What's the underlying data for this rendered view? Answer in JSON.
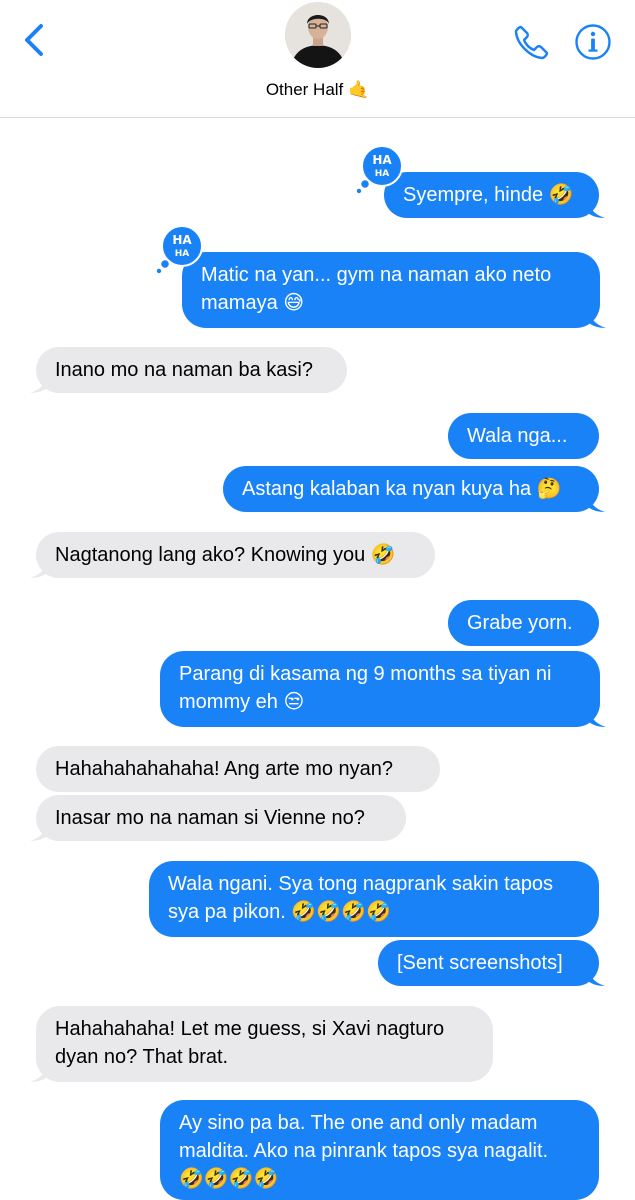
{
  "contact": {
    "name": "Other Half 🤙"
  },
  "tapback": {
    "line1": "HA",
    "line2": "HA"
  },
  "messages": [
    {
      "dir": "sent",
      "lines": [
        "Syempre, hinde 🤣"
      ]
    },
    {
      "dir": "sent",
      "lines": [
        "Matic na yan... gym na naman ako neto",
        "mamaya 😅"
      ]
    },
    {
      "dir": "recv",
      "lines": [
        "Inano mo na naman ba kasi?"
      ]
    },
    {
      "dir": "sent",
      "lines": [
        "Wala nga..."
      ]
    },
    {
      "dir": "sent",
      "lines": [
        "Astang kalaban ka nyan kuya ha 🤔"
      ]
    },
    {
      "dir": "recv",
      "lines": [
        "Nagtanong lang ako? Knowing you 🤣"
      ]
    },
    {
      "dir": "sent",
      "lines": [
        "Grabe yorn."
      ]
    },
    {
      "dir": "sent",
      "lines": [
        "Parang di kasama ng 9 months sa tiyan ni",
        "mommy eh 😒"
      ]
    },
    {
      "dir": "recv",
      "lines": [
        "Hahahahahahaha! Ang arte mo nyan?"
      ]
    },
    {
      "dir": "recv",
      "lines": [
        "Inasar mo na naman si Vienne no?"
      ]
    },
    {
      "dir": "sent",
      "lines": [
        "Wala ngani. Sya tong nagprank sakin tapos",
        "sya pa pikon. 🤣🤣🤣🤣"
      ]
    },
    {
      "dir": "sent",
      "lines": [
        "[Sent screenshots]"
      ]
    },
    {
      "dir": "recv",
      "lines": [
        "Hahahahaha! Let me guess, si Xavi nagturo",
        "dyan no? That brat."
      ]
    },
    {
      "dir": "sent",
      "lines": [
        "Ay sino pa ba. The one and only madam",
        "maldita. Ako na pinrank tapos sya nagalit.",
        "🤣🤣🤣🤣"
      ]
    }
  ],
  "colors": {
    "sent": "#1a82f7",
    "received": "#e9e9eb",
    "accent": "#1a82f7"
  }
}
